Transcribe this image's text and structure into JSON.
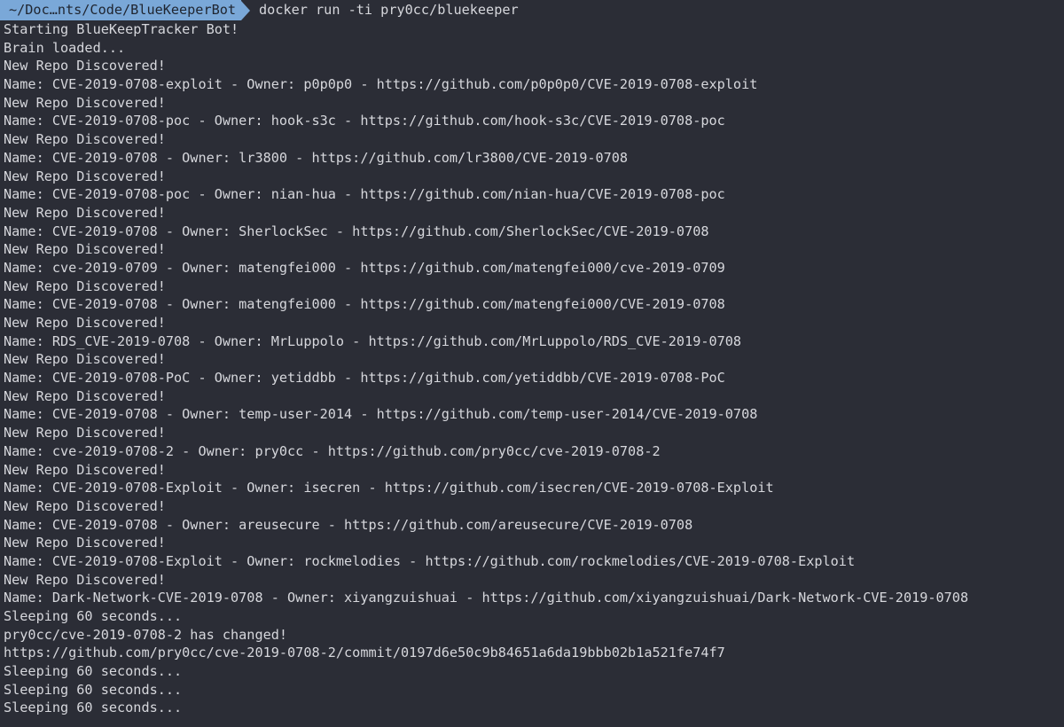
{
  "terminal": {
    "prompt_path": "~/Doc…nts/Code/BlueKeeperBot",
    "command": "docker run -ti pry0cc/bluekeeper",
    "accent_color": "#7aa8d8",
    "lines": [
      "Starting BlueKeepTracker Bot!",
      "Brain loaded...",
      "New Repo Discovered!",
      "Name: CVE-2019-0708-exploit - Owner: p0p0p0 - https://github.com/p0p0p0/CVE-2019-0708-exploit",
      "New Repo Discovered!",
      "Name: CVE-2019-0708-poc - Owner: hook-s3c - https://github.com/hook-s3c/CVE-2019-0708-poc",
      "New Repo Discovered!",
      "Name: CVE-2019-0708 - Owner: lr3800 - https://github.com/lr3800/CVE-2019-0708",
      "New Repo Discovered!",
      "Name: CVE-2019-0708-poc - Owner: nian-hua - https://github.com/nian-hua/CVE-2019-0708-poc",
      "New Repo Discovered!",
      "Name: CVE-2019-0708 - Owner: SherlockSec - https://github.com/SherlockSec/CVE-2019-0708",
      "New Repo Discovered!",
      "Name: cve-2019-0709 - Owner: matengfei000 - https://github.com/matengfei000/cve-2019-0709",
      "New Repo Discovered!",
      "Name: CVE-2019-0708 - Owner: matengfei000 - https://github.com/matengfei000/CVE-2019-0708",
      "New Repo Discovered!",
      "Name: RDS_CVE-2019-0708 - Owner: MrLuppolo - https://github.com/MrLuppolo/RDS_CVE-2019-0708",
      "New Repo Discovered!",
      "Name: CVE-2019-0708-PoC - Owner: yetiddbb - https://github.com/yetiddbb/CVE-2019-0708-PoC",
      "New Repo Discovered!",
      "Name: CVE-2019-0708 - Owner: temp-user-2014 - https://github.com/temp-user-2014/CVE-2019-0708",
      "New Repo Discovered!",
      "Name: cve-2019-0708-2 - Owner: pry0cc - https://github.com/pry0cc/cve-2019-0708-2",
      "New Repo Discovered!",
      "Name: CVE-2019-0708-Exploit - Owner: isecren - https://github.com/isecren/CVE-2019-0708-Exploit",
      "New Repo Discovered!",
      "Name: CVE-2019-0708 - Owner: areusecure - https://github.com/areusecure/CVE-2019-0708",
      "New Repo Discovered!",
      "Name: CVE-2019-0708-Exploit - Owner: rockmelodies - https://github.com/rockmelodies/CVE-2019-0708-Exploit",
      "New Repo Discovered!",
      "Name: Dark-Network-CVE-2019-0708 - Owner: xiyangzuishuai - https://github.com/xiyangzuishuai/Dark-Network-CVE-2019-0708",
      "Sleeping 60 seconds...",
      "pry0cc/cve-2019-0708-2 has changed!",
      "https://github.com/pry0cc/cve-2019-0708-2/commit/0197d6e50c9b84651a6da19bbb02b1a521fe74f7",
      "Sleeping 60 seconds...",
      "Sleeping 60 seconds...",
      "Sleeping 60 seconds..."
    ]
  }
}
